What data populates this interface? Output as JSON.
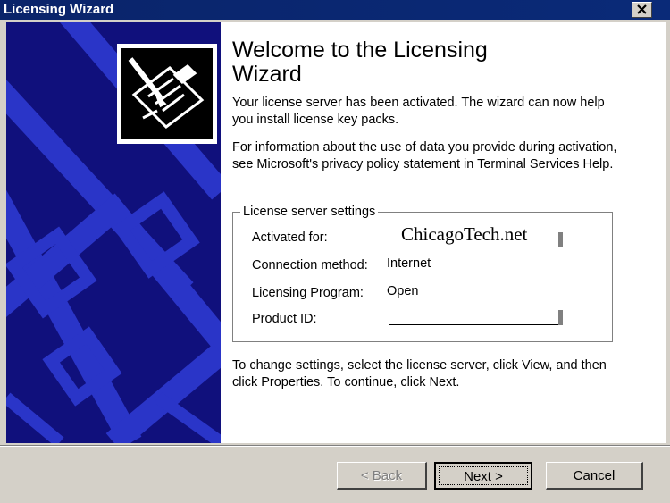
{
  "window": {
    "title": "Licensing Wizard",
    "close_icon": "close-x-icon"
  },
  "sidebar": {
    "logo_icon": "certificate-pen-icon",
    "colors": {
      "background": "#10107c",
      "pattern": "#2a35c8"
    }
  },
  "main": {
    "heading": "Welcome to the Licensing Wizard",
    "intro": "Your license server has been activated. The wizard can now help you install license key packs.",
    "privacy": "For information about the use of data you provide during activation, see Microsoft's privacy policy statement in Terminal Services Help.",
    "settings": {
      "legend": "License server settings",
      "rows": [
        {
          "label": "Activated for:",
          "value": "ChicagoTech.net"
        },
        {
          "label": "Connection method:",
          "value": "Internet"
        },
        {
          "label": "Licensing Program:",
          "value": "Open"
        },
        {
          "label": "Product ID:",
          "value": ""
        }
      ]
    },
    "footer_text": "To change settings, select the license server, click View, and then click Properties. To continue, click Next."
  },
  "buttons": {
    "back": "< Back",
    "next": "Next >",
    "cancel": "Cancel"
  }
}
